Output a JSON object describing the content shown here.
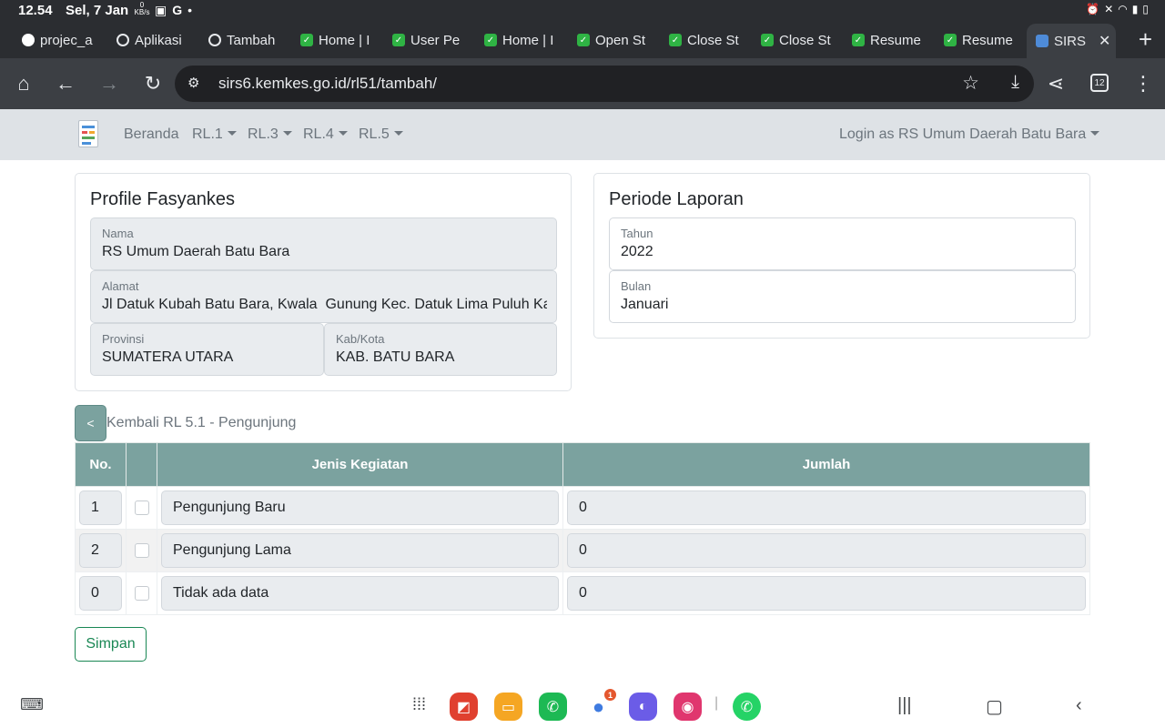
{
  "status_bar": {
    "time": "12.54",
    "date": "Sel, 7 Jan",
    "speed_value": "0",
    "speed_unit": "KB/s"
  },
  "tabs": [
    {
      "label": "projec_a",
      "icon": "github-icon"
    },
    {
      "label": "Aplikasi",
      "icon": "globe-icon"
    },
    {
      "label": "Tambah",
      "icon": "globe-icon"
    },
    {
      "label": "Home | I",
      "icon": "check-shield-icon"
    },
    {
      "label": "User Pe",
      "icon": "check-shield-icon"
    },
    {
      "label": "Home | I",
      "icon": "check-shield-icon"
    },
    {
      "label": "Open St",
      "icon": "check-shield-icon"
    },
    {
      "label": "Close St",
      "icon": "check-shield-icon"
    },
    {
      "label": "Close St",
      "icon": "check-shield-icon"
    },
    {
      "label": "Resume",
      "icon": "check-shield-icon"
    },
    {
      "label": "Resume",
      "icon": "check-shield-icon"
    },
    {
      "label": "SIRS",
      "icon": "sirs-icon",
      "active": true
    }
  ],
  "browser": {
    "url": "sirs6.kemkes.go.id/rl51/tambah/",
    "tab_count": "12"
  },
  "navbar": {
    "items": [
      {
        "label": "Beranda"
      },
      {
        "label": "RL.1"
      },
      {
        "label": "RL.3"
      },
      {
        "label": "RL.4"
      },
      {
        "label": "RL.5"
      }
    ],
    "login": "Login as RS Umum Daerah Batu Bara"
  },
  "profile": {
    "title": "Profile Fasyankes",
    "nama_label": "Nama",
    "nama": "RS Umum Daerah Batu Bara",
    "alamat_label": "Alamat",
    "alamat": "Jl Datuk Kubah Batu Bara, Kwala  Gunung Kec. Datuk Lima Puluh Kab",
    "provinsi_label": "Provinsi",
    "provinsi": "SUMATERA UTARA",
    "kabkota_label": "Kab/Kota",
    "kabkota": "KAB. BATU BARA"
  },
  "periode": {
    "title": "Periode Laporan",
    "tahun_label": "Tahun",
    "tahun": "2022",
    "bulan_label": "Bulan",
    "bulan": "Januari"
  },
  "back": {
    "button": "<",
    "label": "Kembali RL 5.1 - Pengunjung"
  },
  "table": {
    "headers": {
      "no": "No.",
      "check": "",
      "jenis": "Jenis Kegiatan",
      "jumlah": "Jumlah"
    },
    "rows": [
      {
        "no": "1",
        "jenis": "Pengunjung Baru",
        "jumlah": "0"
      },
      {
        "no": "2",
        "jenis": "Pengunjung Lama",
        "jumlah": "0"
      },
      {
        "no": "0",
        "jenis": "Tidak ada data",
        "jumlah": "0"
      }
    ]
  },
  "save_button": "Simpan",
  "colors": {
    "table_header": "#7ba29f",
    "navbar_bg": "#dee2e6",
    "save_green": "#198754"
  }
}
